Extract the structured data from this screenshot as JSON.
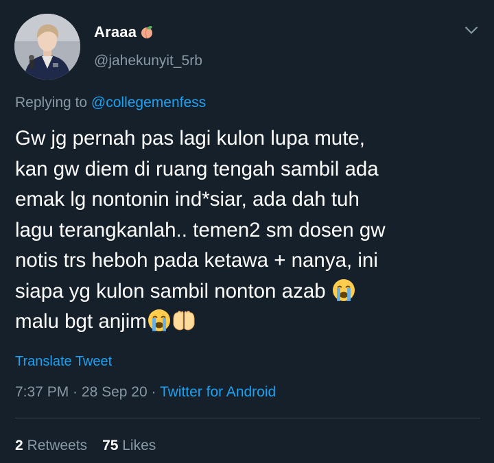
{
  "user": {
    "display_name": "Araaa",
    "handle": "@jahekunyit_5rb",
    "name_emoji": "peach-icon"
  },
  "reply": {
    "prefix": "Replying to ",
    "mention": "@collegemenfess"
  },
  "tweet": {
    "lines": [
      "Gw jg pernah pas lagi kulon lupa mute,",
      "kan gw diem di ruang tengah sambil ada",
      "emak lg nontonin ind*siar, ada dah tuh",
      "lagu terangkanlah.. temen2 sm dosen gw",
      "notis trs heboh pada ketawa + nanya, ini",
      "siapa yg kulon sambil nonton azab ",
      "malu bgt anjim"
    ]
  },
  "translate_label": "Translate Tweet",
  "meta": {
    "time": "7:37 PM",
    "separator": " · ",
    "date": "28 Sep 20",
    "separator2": " · ",
    "source": "Twitter for Android"
  },
  "stats": {
    "retweets_count": "2",
    "retweets_label": " Retweets",
    "likes_count": "75",
    "likes_label": " Likes"
  },
  "colors": {
    "background": "#15202b",
    "text": "#ffffff",
    "secondary": "#8899a6",
    "accent": "#1da1f2",
    "divider": "#38444d"
  }
}
